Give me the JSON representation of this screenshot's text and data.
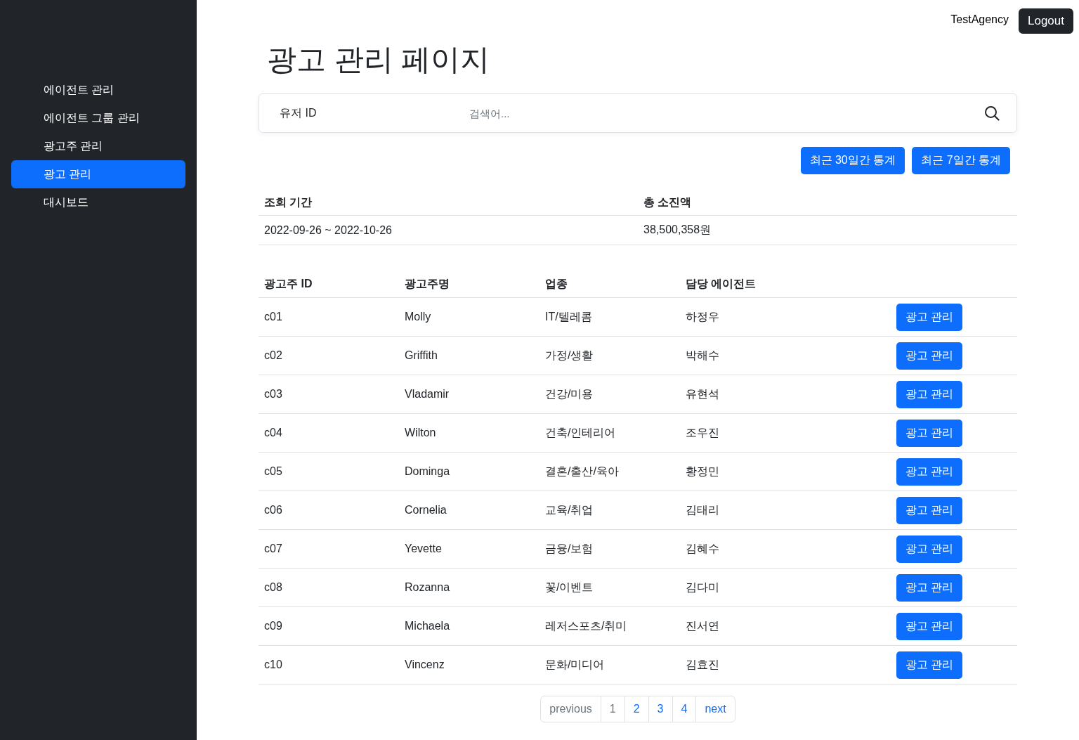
{
  "sidebar": {
    "items": [
      {
        "label": "에이전트 관리",
        "selected": false
      },
      {
        "label": "에이전트 그룹 관리",
        "selected": false
      },
      {
        "label": "광고주 관리",
        "selected": false
      },
      {
        "label": "광고 관리",
        "selected": true
      },
      {
        "label": "대시보드",
        "selected": false
      }
    ]
  },
  "header": {
    "user": "TestAgency",
    "logout": "Logout"
  },
  "title": "광고 관리 페이지",
  "search": {
    "label": "유저 ID",
    "placeholder": "검색어..."
  },
  "stat_buttons": [
    "최근 30일간 통계",
    "최근 7일간 통계"
  ],
  "summary": {
    "columns": [
      "조회 기간",
      "총 소진액"
    ],
    "row": [
      "2022-09-26 ~ 2022-10-26",
      "38,500,358원"
    ]
  },
  "table": {
    "columns": [
      "광고주 ID",
      "광고주명",
      "업종",
      "담당 에이전트"
    ],
    "rows": [
      {
        "cells": [
          "c01",
          "Molly",
          "IT/텔레콤",
          "하정우"
        ],
        "action": "광고 관리"
      },
      {
        "cells": [
          "c02",
          "Griffith",
          "가정/생활",
          "박해수"
        ],
        "action": "광고 관리"
      },
      {
        "cells": [
          "c03",
          "Vladamir",
          "건강/미용",
          "유현석"
        ],
        "action": "광고 관리"
      },
      {
        "cells": [
          "c04",
          "Wilton",
          "건축/인테리어",
          "조우진"
        ],
        "action": "광고 관리"
      },
      {
        "cells": [
          "c05",
          "Dominga",
          "결혼/출산/육아",
          "황정민"
        ],
        "action": "광고 관리"
      },
      {
        "cells": [
          "c06",
          "Cornelia",
          "교육/취업",
          "김태리"
        ],
        "action": "광고 관리"
      },
      {
        "cells": [
          "c07",
          "Yevette",
          "금융/보험",
          "김혜수"
        ],
        "action": "광고 관리"
      },
      {
        "cells": [
          "c08",
          "Rozanna",
          "꽃/이벤트",
          "김다미"
        ],
        "action": "광고 관리"
      },
      {
        "cells": [
          "c09",
          "Michaela",
          "레저스포츠/취미",
          "진서연"
        ],
        "action": "광고 관리"
      },
      {
        "cells": [
          "c10",
          "Vincenz",
          "문화/미디어",
          "김효진"
        ],
        "action": "광고 관리"
      }
    ]
  },
  "pagination": {
    "previous": {
      "label": "previous",
      "disabled": true
    },
    "pages": [
      {
        "label": "1",
        "selected": true
      },
      {
        "label": "2",
        "selected": false
      },
      {
        "label": "3",
        "selected": false
      },
      {
        "label": "4",
        "selected": false
      }
    ],
    "next": {
      "label": "next",
      "disabled": false
    }
  }
}
